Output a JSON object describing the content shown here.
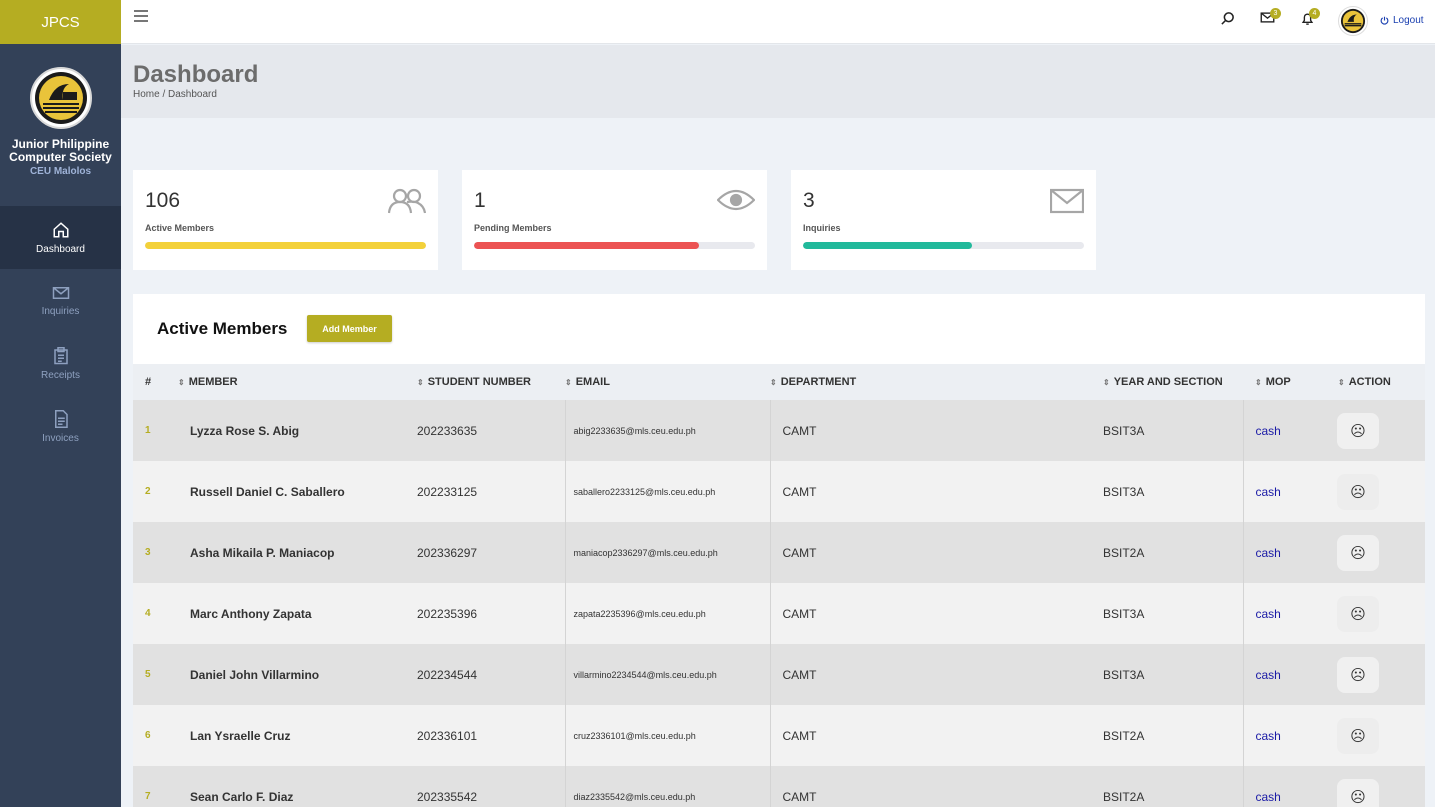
{
  "sidebar": {
    "brand": "JPCS",
    "org_name": "Junior Philippine Computer Society",
    "org_sub": "CEU Malolos",
    "items": [
      {
        "label": "Dashboard",
        "icon": "home-icon",
        "active": true
      },
      {
        "label": "Inquiries",
        "icon": "mail-icon",
        "active": false
      },
      {
        "label": "Receipts",
        "icon": "clipboard-icon",
        "active": false
      },
      {
        "label": "Invoices",
        "icon": "document-icon",
        "active": false
      }
    ]
  },
  "topbar": {
    "messages_badge": "3",
    "notifications_badge": "4",
    "logout_label": "Logout"
  },
  "page": {
    "title": "Dashboard",
    "breadcrumb": "Home / Dashboard"
  },
  "stats": [
    {
      "value": "106",
      "label": "Active Members",
      "progress": 1.0,
      "color": "#f3d13a",
      "icon": "users-icon"
    },
    {
      "value": "1",
      "label": "Pending Members",
      "progress": 0.8,
      "color": "#ec5353",
      "icon": "eye-icon"
    },
    {
      "value": "3",
      "label": "Inquiries",
      "progress": 0.6,
      "color": "#21b99b",
      "icon": "envelope-icon"
    }
  ],
  "members": {
    "title": "Active Members",
    "add_label": "Add Member",
    "columns": [
      "#",
      "MEMBER",
      "STUDENT NUMBER",
      "EMAIL",
      "DEPARTMENT",
      "YEAR AND SECTION",
      "MOP",
      "ACTION"
    ],
    "rows": [
      {
        "idx": "1",
        "name": "Lyzza Rose S. Abig",
        "student_no": "202233635",
        "email": "abig2233635@mls.ceu.edu.ph",
        "dept": "CAMT",
        "section": "BSIT3A",
        "mop": "cash",
        "action": "☹"
      },
      {
        "idx": "2",
        "name": "Russell Daniel C. Saballero",
        "student_no": "202233125",
        "email": "saballero2233125@mls.ceu.edu.ph",
        "dept": "CAMT",
        "section": "BSIT3A",
        "mop": "cash",
        "action": "☹"
      },
      {
        "idx": "3",
        "name": "Asha Mikaila P. Maniacop",
        "student_no": "202336297",
        "email": "maniacop2336297@mls.ceu.edu.ph",
        "dept": "CAMT",
        "section": "BSIT2A",
        "mop": "cash",
        "action": "☹"
      },
      {
        "idx": "4",
        "name": "Marc Anthony Zapata",
        "student_no": "202235396",
        "email": "zapata2235396@mls.ceu.edu.ph",
        "dept": "CAMT",
        "section": "BSIT3A",
        "mop": "cash",
        "action": "☹"
      },
      {
        "idx": "5",
        "name": "Daniel John Villarmino",
        "student_no": "202234544",
        "email": "villarmino2234544@mls.ceu.edu.ph",
        "dept": "CAMT",
        "section": "BSIT3A",
        "mop": "cash",
        "action": "☹"
      },
      {
        "idx": "6",
        "name": "Lan Ysraelle Cruz",
        "student_no": "202336101",
        "email": "cruz2336101@mls.ceu.edu.ph",
        "dept": "CAMT",
        "section": "BSIT2A",
        "mop": "cash",
        "action": "☹"
      },
      {
        "idx": "7",
        "name": "Sean Carlo F. Diaz",
        "student_no": "202335542",
        "email": "diaz2335542@mls.ceu.edu.ph",
        "dept": "CAMT",
        "section": "BSIT2A",
        "mop": "cash",
        "action": "☹"
      }
    ]
  }
}
